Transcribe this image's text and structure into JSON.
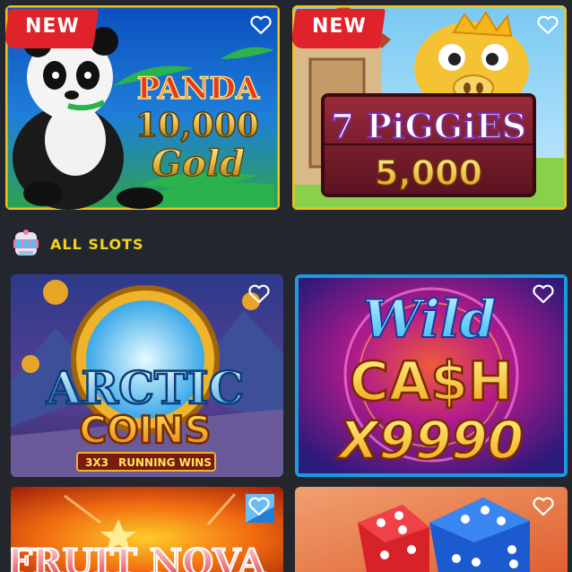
{
  "featured": [
    {
      "badge": "NEW",
      "title_line1": "PANDA",
      "title_line2": "10,000",
      "title_line3": "Gold"
    },
    {
      "badge": "NEW",
      "title_line1": "7 PiGGiES",
      "title_line2": "5,000"
    }
  ],
  "section": {
    "title": "ALL SLOTS",
    "icon": "slot-machine-icon"
  },
  "slots": [
    {
      "title_line1": "ARCTIC",
      "title_line2": "COINS",
      "subtitle_a": "3X3",
      "subtitle_b": "RUNNING WINS"
    },
    {
      "title_line1": "Wild",
      "title_line2": "CA$H",
      "title_line3": "X9990"
    },
    {
      "title_line1": "FRUIT NOVA"
    },
    {
      "title_line1": ""
    }
  ],
  "colors": {
    "background": "#23262d",
    "accent": "#f5d21b",
    "badge": "#e0232b"
  }
}
